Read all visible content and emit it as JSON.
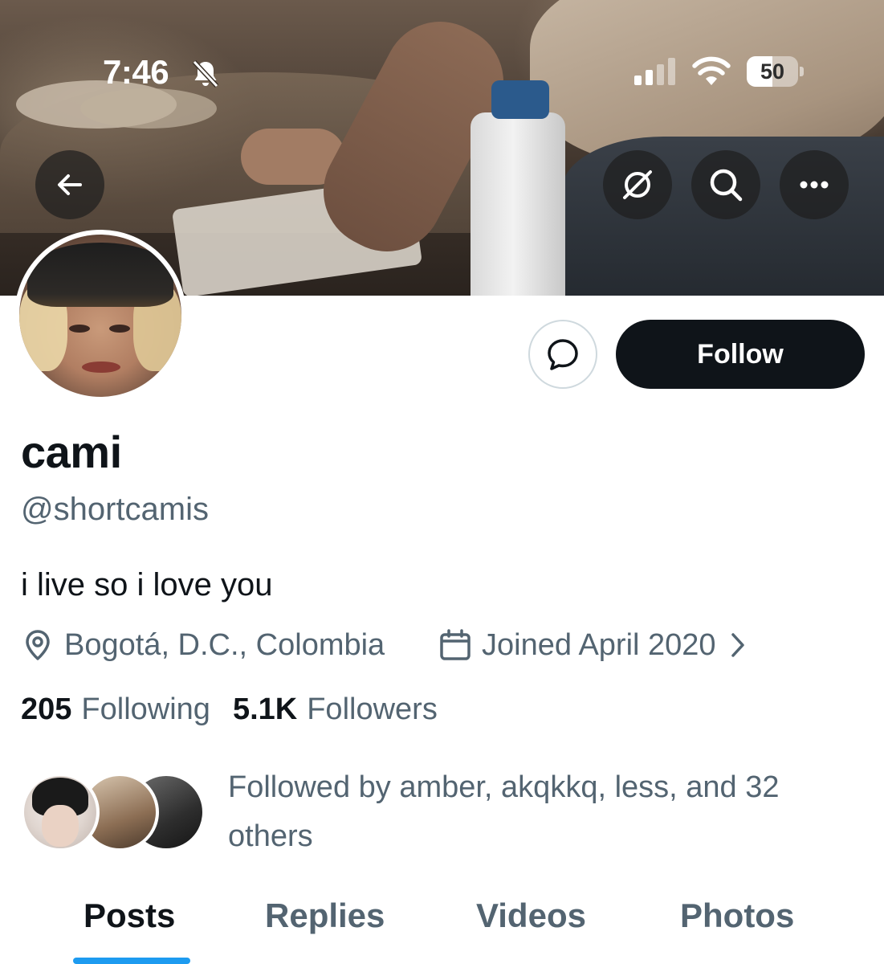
{
  "status_bar": {
    "time": "7:46",
    "battery_level": "50",
    "battery_fraction": 0.5
  },
  "banner_icons": {
    "back": "arrow-left-icon",
    "grok": "grok-icon",
    "search": "search-icon",
    "more": "more-icon"
  },
  "actions": {
    "message_icon": "message-icon",
    "follow_label": "Follow"
  },
  "profile": {
    "name": "cami",
    "handle": "@shortcamis",
    "bio": "i live so i love you",
    "location": "Bogotá, D.C., Colombia",
    "joined": "Joined April 2020",
    "following_count": "205",
    "following_label": "Following",
    "followers_count": "5.1K",
    "followers_label": "Followers",
    "followed_by": "Followed by amber, akqkkq, less, and 32 others"
  },
  "tabs": [
    {
      "label": "Posts",
      "active": true
    },
    {
      "label": "Replies",
      "active": false
    },
    {
      "label": "Videos",
      "active": false
    },
    {
      "label": "Photos",
      "active": false
    }
  ],
  "colors": {
    "text_primary": "#0f1419",
    "text_secondary": "#536471",
    "accent": "#1d9bf0",
    "follow_bg": "#0f1419"
  }
}
